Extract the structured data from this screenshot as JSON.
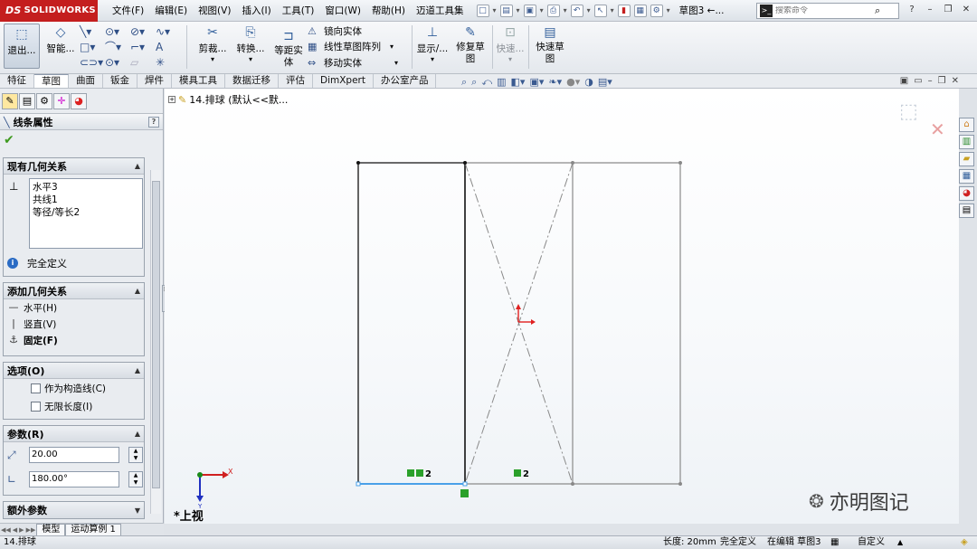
{
  "app": {
    "logo_prefix": "DS",
    "logo_text": "SOLIDWORKS",
    "document_title": "草图3 ←...",
    "menu": [
      "文件(F)",
      "编辑(E)",
      "视图(V)",
      "插入(I)",
      "工具(T)",
      "窗口(W)",
      "帮助(H)",
      "迈道工具集"
    ],
    "search_placeholder": "搜索命令",
    "brand_color": "#c41e1e"
  },
  "ribbon": {
    "exit_label": "退出...",
    "smart_dim_label": "智能...",
    "trim_label": "剪裁...",
    "convert_label": "转换...",
    "offset_label_1": "等距实",
    "offset_label_2": "体",
    "mirror_label": "镜向实体",
    "linear_pattern_label": "线性草图阵列",
    "move_label": "移动实体",
    "display_label": "显示/...",
    "repair_label_1": "修复草",
    "repair_label_2": "图",
    "quick_snap_label": "快速...",
    "rapid_sketch_label_1": "快速草",
    "rapid_sketch_label_2": "图"
  },
  "tabs": [
    "特征",
    "草图",
    "曲面",
    "钣金",
    "焊件",
    "模具工具",
    "数据迁移",
    "评估",
    "DimXpert",
    "办公室产品"
  ],
  "active_tab": "草图",
  "property_manager": {
    "title": "线条属性",
    "help": "?",
    "existing_relations": {
      "header": "现有几何关系",
      "items": [
        "水平3",
        "共线1",
        "等径/等长2"
      ],
      "status": "完全定义"
    },
    "add_relations": {
      "header": "添加几何关系",
      "items": [
        "水平(H)",
        "竖直(V)",
        "固定(F)"
      ]
    },
    "options": {
      "header": "选项(O)",
      "items": [
        "作为构造线(C)",
        "无限长度(I)"
      ]
    },
    "parameters": {
      "header": "参数(R)",
      "length": "20.00",
      "angle": "180.00°"
    },
    "extra_params": {
      "header": "额外参数"
    }
  },
  "bottom_tabs": [
    "模型",
    "运动算例 1"
  ],
  "graphics": {
    "tree_root": "14.排球 (默认<<默...",
    "view_name": "*上视",
    "relation_tag_1": "2",
    "relation_tag_2": "2",
    "axis_x": "X",
    "axis_y": "Y",
    "watermark": "亦明图记"
  },
  "status": {
    "file": "14.排球",
    "length": "长度: 20mm",
    "defined": "完全定义",
    "editing": "在编辑 草图3",
    "custom": "自定义"
  }
}
